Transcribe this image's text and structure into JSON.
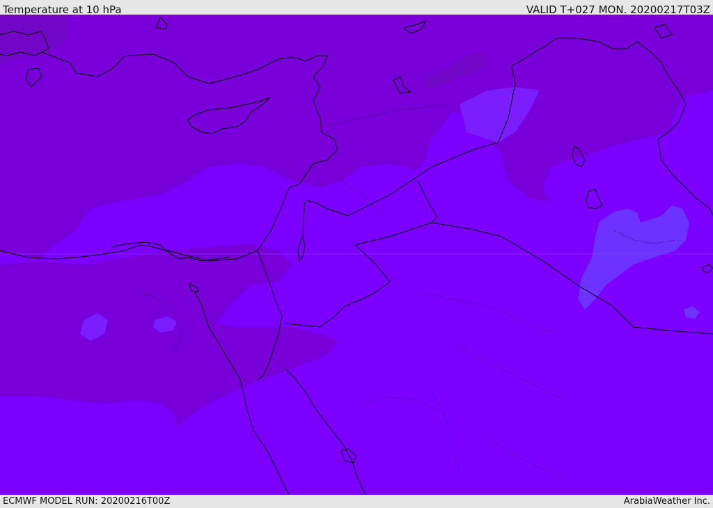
{
  "header": {
    "title": "Temperature at 10 hPa",
    "valid_time": "VALID T+027 MON. 20200217T03Z"
  },
  "footer": {
    "model_run": "ECMWF MODEL RUN: 20200216T00Z",
    "credit": "ArabiaWeather Inc."
  },
  "colors": {
    "base_fill": "#7b00ff",
    "dark_fill": "#7800d8",
    "darker_fill": "#7206c6",
    "light_fill": "#7a1dff",
    "lighter_fill": "#6c33ff",
    "coastline": "#000000",
    "header_bg": "#e6e6e6"
  }
}
